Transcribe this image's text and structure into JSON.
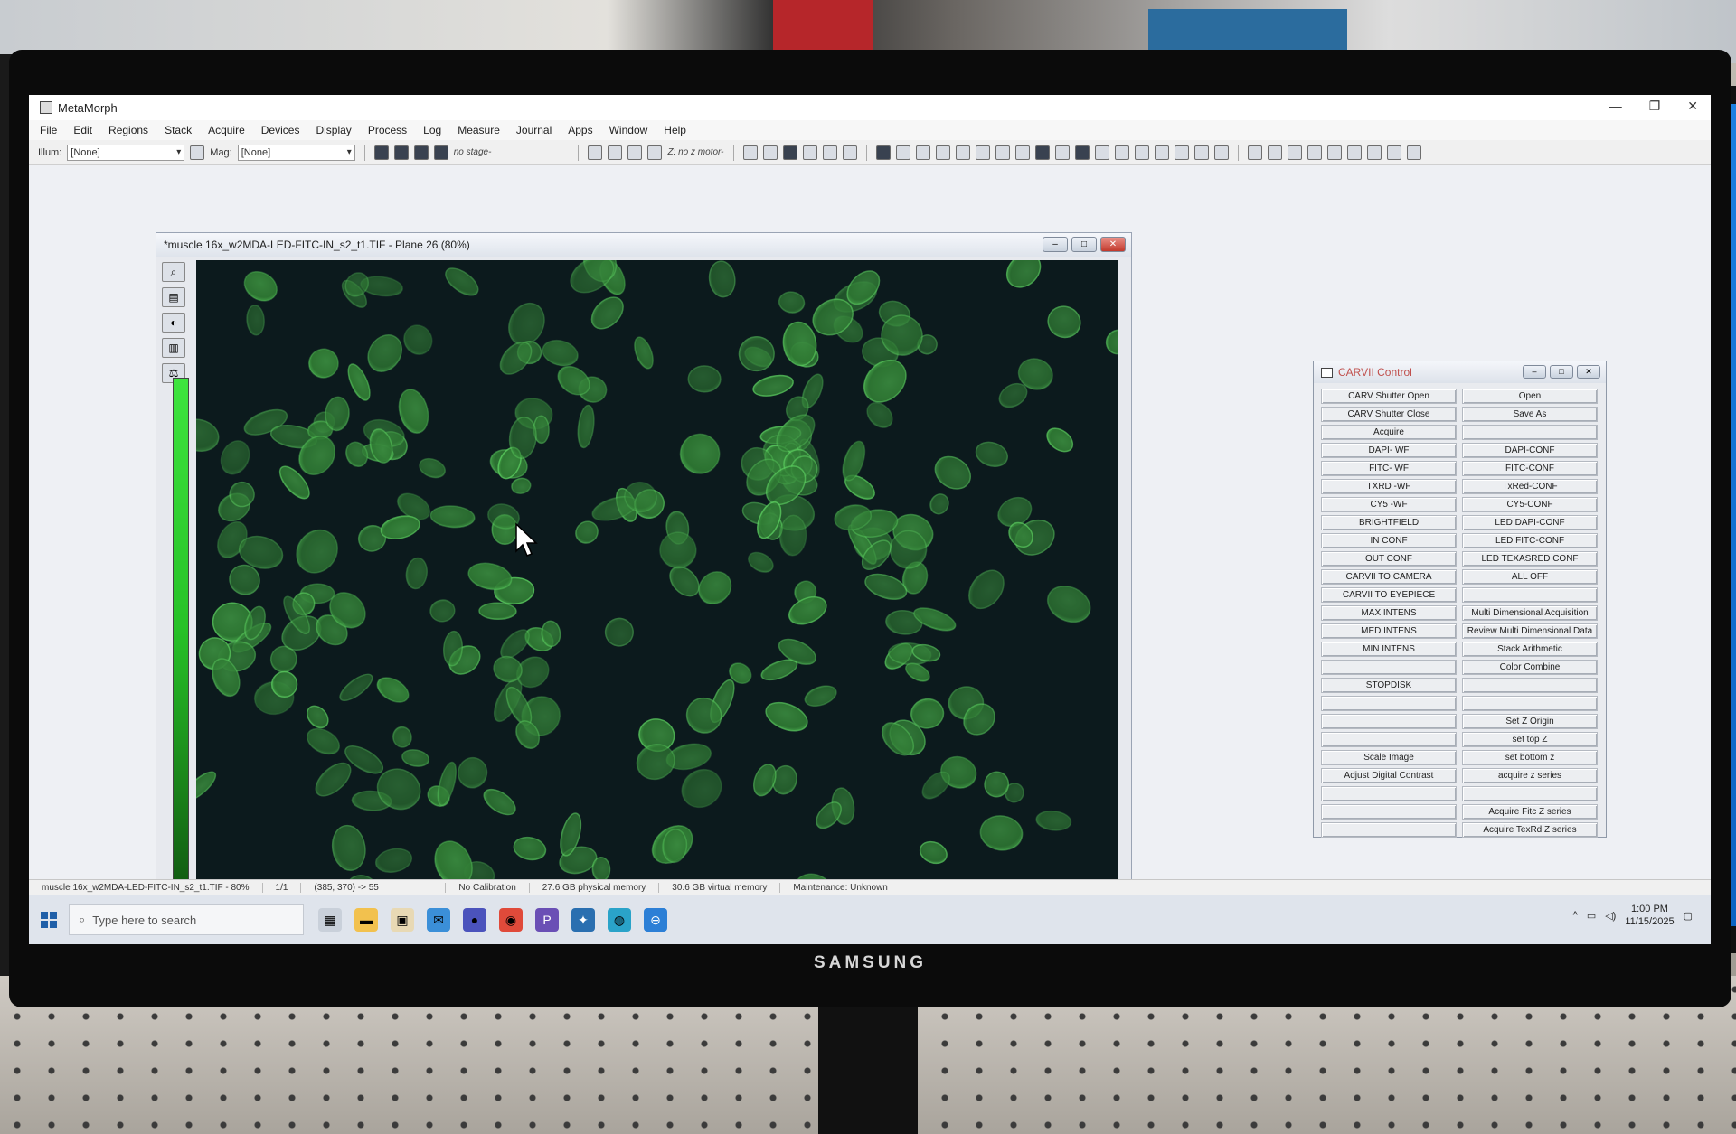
{
  "app": {
    "title": "MetaMorph",
    "window_controls": [
      "—",
      "❐",
      "✕"
    ]
  },
  "menu": [
    "File",
    "Edit",
    "Regions",
    "Stack",
    "Acquire",
    "Devices",
    "Display",
    "Process",
    "Log",
    "Measure",
    "Journal",
    "Apps",
    "Window",
    "Help"
  ],
  "toolbar": {
    "illum_label": "Illum:",
    "illum_value": "[None]",
    "mag_label": "Mag:",
    "mag_value": "[None]",
    "stage_text": "no stage-",
    "zmotor_text": "Z: no z motor-"
  },
  "image_window": {
    "title": "*muscle 16x_w2MDA-LED-FITC-IN_s2_t1.TIF - Plane 26 (80%)"
  },
  "panel": {
    "title": "CARVII Control",
    "left_buttons": [
      "CARV Shutter Open",
      "CARV Shutter Close",
      "Acquire",
      "DAPI- WF",
      "FITC- WF",
      "TXRD -WF",
      "CY5 -WF",
      "BRIGHTFIELD",
      "IN CONF",
      "OUT CONF",
      "CARVII TO CAMERA",
      "CARVII TO EYEPIECE",
      "MAX INTENS",
      "MED INTENS",
      "MIN INTENS",
      "",
      "STOPDISK",
      "",
      "",
      "",
      "Scale Image",
      "Adjust Digital Contrast",
      "",
      "",
      ""
    ],
    "right_buttons": [
      "Open",
      "Save As",
      "",
      "DAPI-CONF",
      "FITC-CONF",
      "TxRed-CONF",
      "CY5-CONF",
      "LED DAPI-CONF",
      "LED FITC-CONF",
      "LED TEXASRED CONF",
      "ALL OFF",
      "",
      "Multi Dimensional Acquisition",
      "Review Multi Dimensional Data",
      "Stack Arithmetic",
      "Color Combine",
      "",
      "",
      "Set Z Origin",
      "set top Z",
      "set bottom z",
      "acquire z series",
      "",
      "Acquire Fitc Z series",
      "Acquire TexRd Z series"
    ]
  },
  "status": {
    "file": "muscle 16x_w2MDA-LED-FITC-IN_s2_t1.TIF - 80%",
    "plane": "1/1",
    "coords": "(385, 370) -> 55",
    "calibration": "No Calibration",
    "physical": "27.6 GB physical memory",
    "virtual": "30.6 GB virtual memory",
    "maintenance": "Maintenance: Unknown"
  },
  "taskbar": {
    "search_placeholder": "Type here to search",
    "time": "1:00 PM",
    "date": "11/15/2025"
  },
  "monitor": {
    "brand": "SAMSUNG"
  }
}
